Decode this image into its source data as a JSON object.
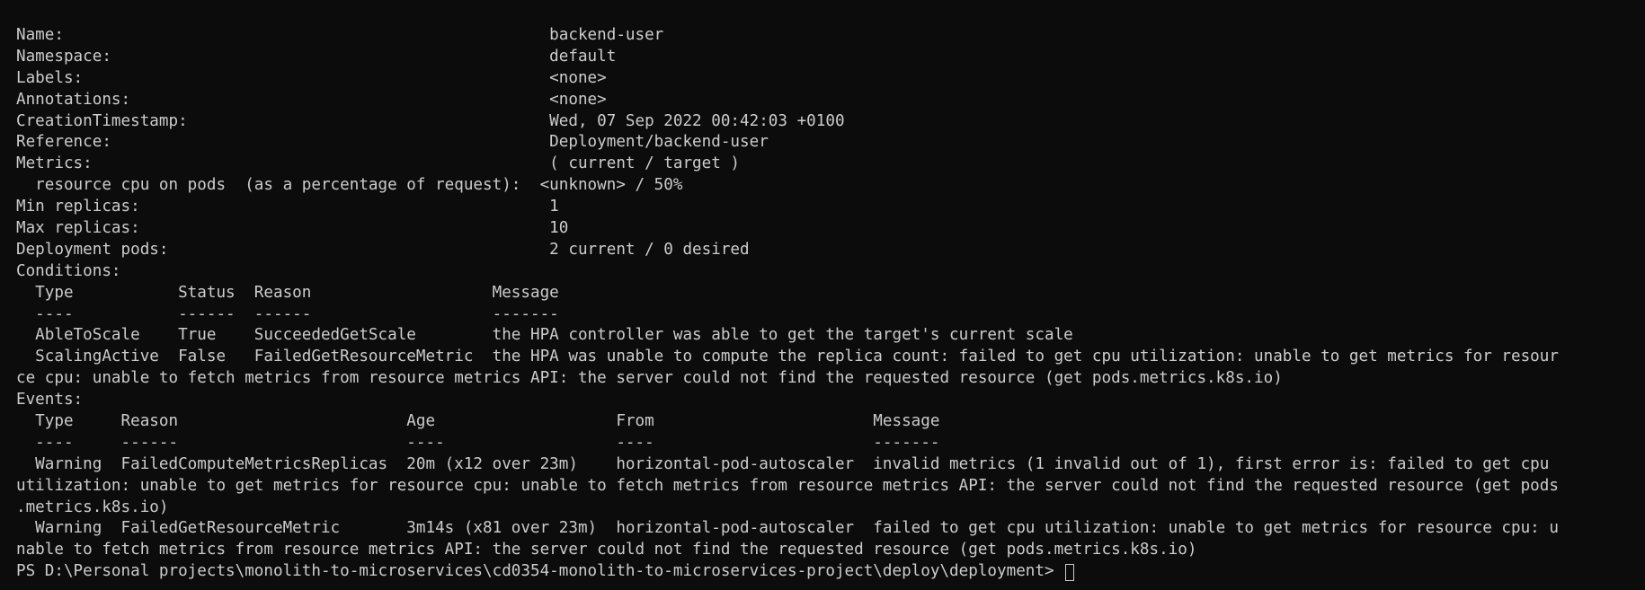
{
  "terminal": {
    "lines": [
      "Name:                                                   backend-user",
      "Namespace:                                              default",
      "Labels:                                                 <none>",
      "Annotations:                                            <none>",
      "CreationTimestamp:                                      Wed, 07 Sep 2022 00:42:03 +0100",
      "Reference:                                              Deployment/backend-user",
      "Metrics:                                                ( current / target )",
      "  resource cpu on pods  (as a percentage of request):  <unknown> / 50%",
      "Min replicas:                                           1",
      "Max replicas:                                           10",
      "Deployment pods:                                        2 current / 0 desired",
      "Conditions:",
      "  Type           Status  Reason                   Message",
      "  ----           ------  ------                   -------",
      "  AbleToScale    True    SucceededGetScale        the HPA controller was able to get the target's current scale",
      "  ScalingActive  False   FailedGetResourceMetric  the HPA was unable to compute the replica count: failed to get cpu utilization: unable to get metrics for resour",
      "ce cpu: unable to fetch metrics from resource metrics API: the server could not find the requested resource (get pods.metrics.k8s.io)",
      "Events:",
      "  Type     Reason                        Age                   From                       Message",
      "  ----     ------                        ----                  ----                       -------",
      "  Warning  FailedComputeMetricsReplicas  20m (x12 over 23m)    horizontal-pod-autoscaler  invalid metrics (1 invalid out of 1), first error is: failed to get cpu",
      "utilization: unable to get metrics for resource cpu: unable to fetch metrics from resource metrics API: the server could not find the requested resource (get pods",
      ".metrics.k8s.io)",
      "  Warning  FailedGetResourceMetric       3m14s (x81 over 23m)  horizontal-pod-autoscaler  failed to get cpu utilization: unable to get metrics for resource cpu: u",
      "nable to fetch metrics from resource metrics API: the server could not find the requested resource (get pods.metrics.k8s.io)"
    ],
    "prompt": "PS D:\\Personal projects\\monolith-to-microservices\\cd0354-monolith-to-microservices-project\\deploy\\deployment> "
  },
  "colors": {
    "background": "#0c0c0c",
    "foreground": "#cccccc"
  }
}
